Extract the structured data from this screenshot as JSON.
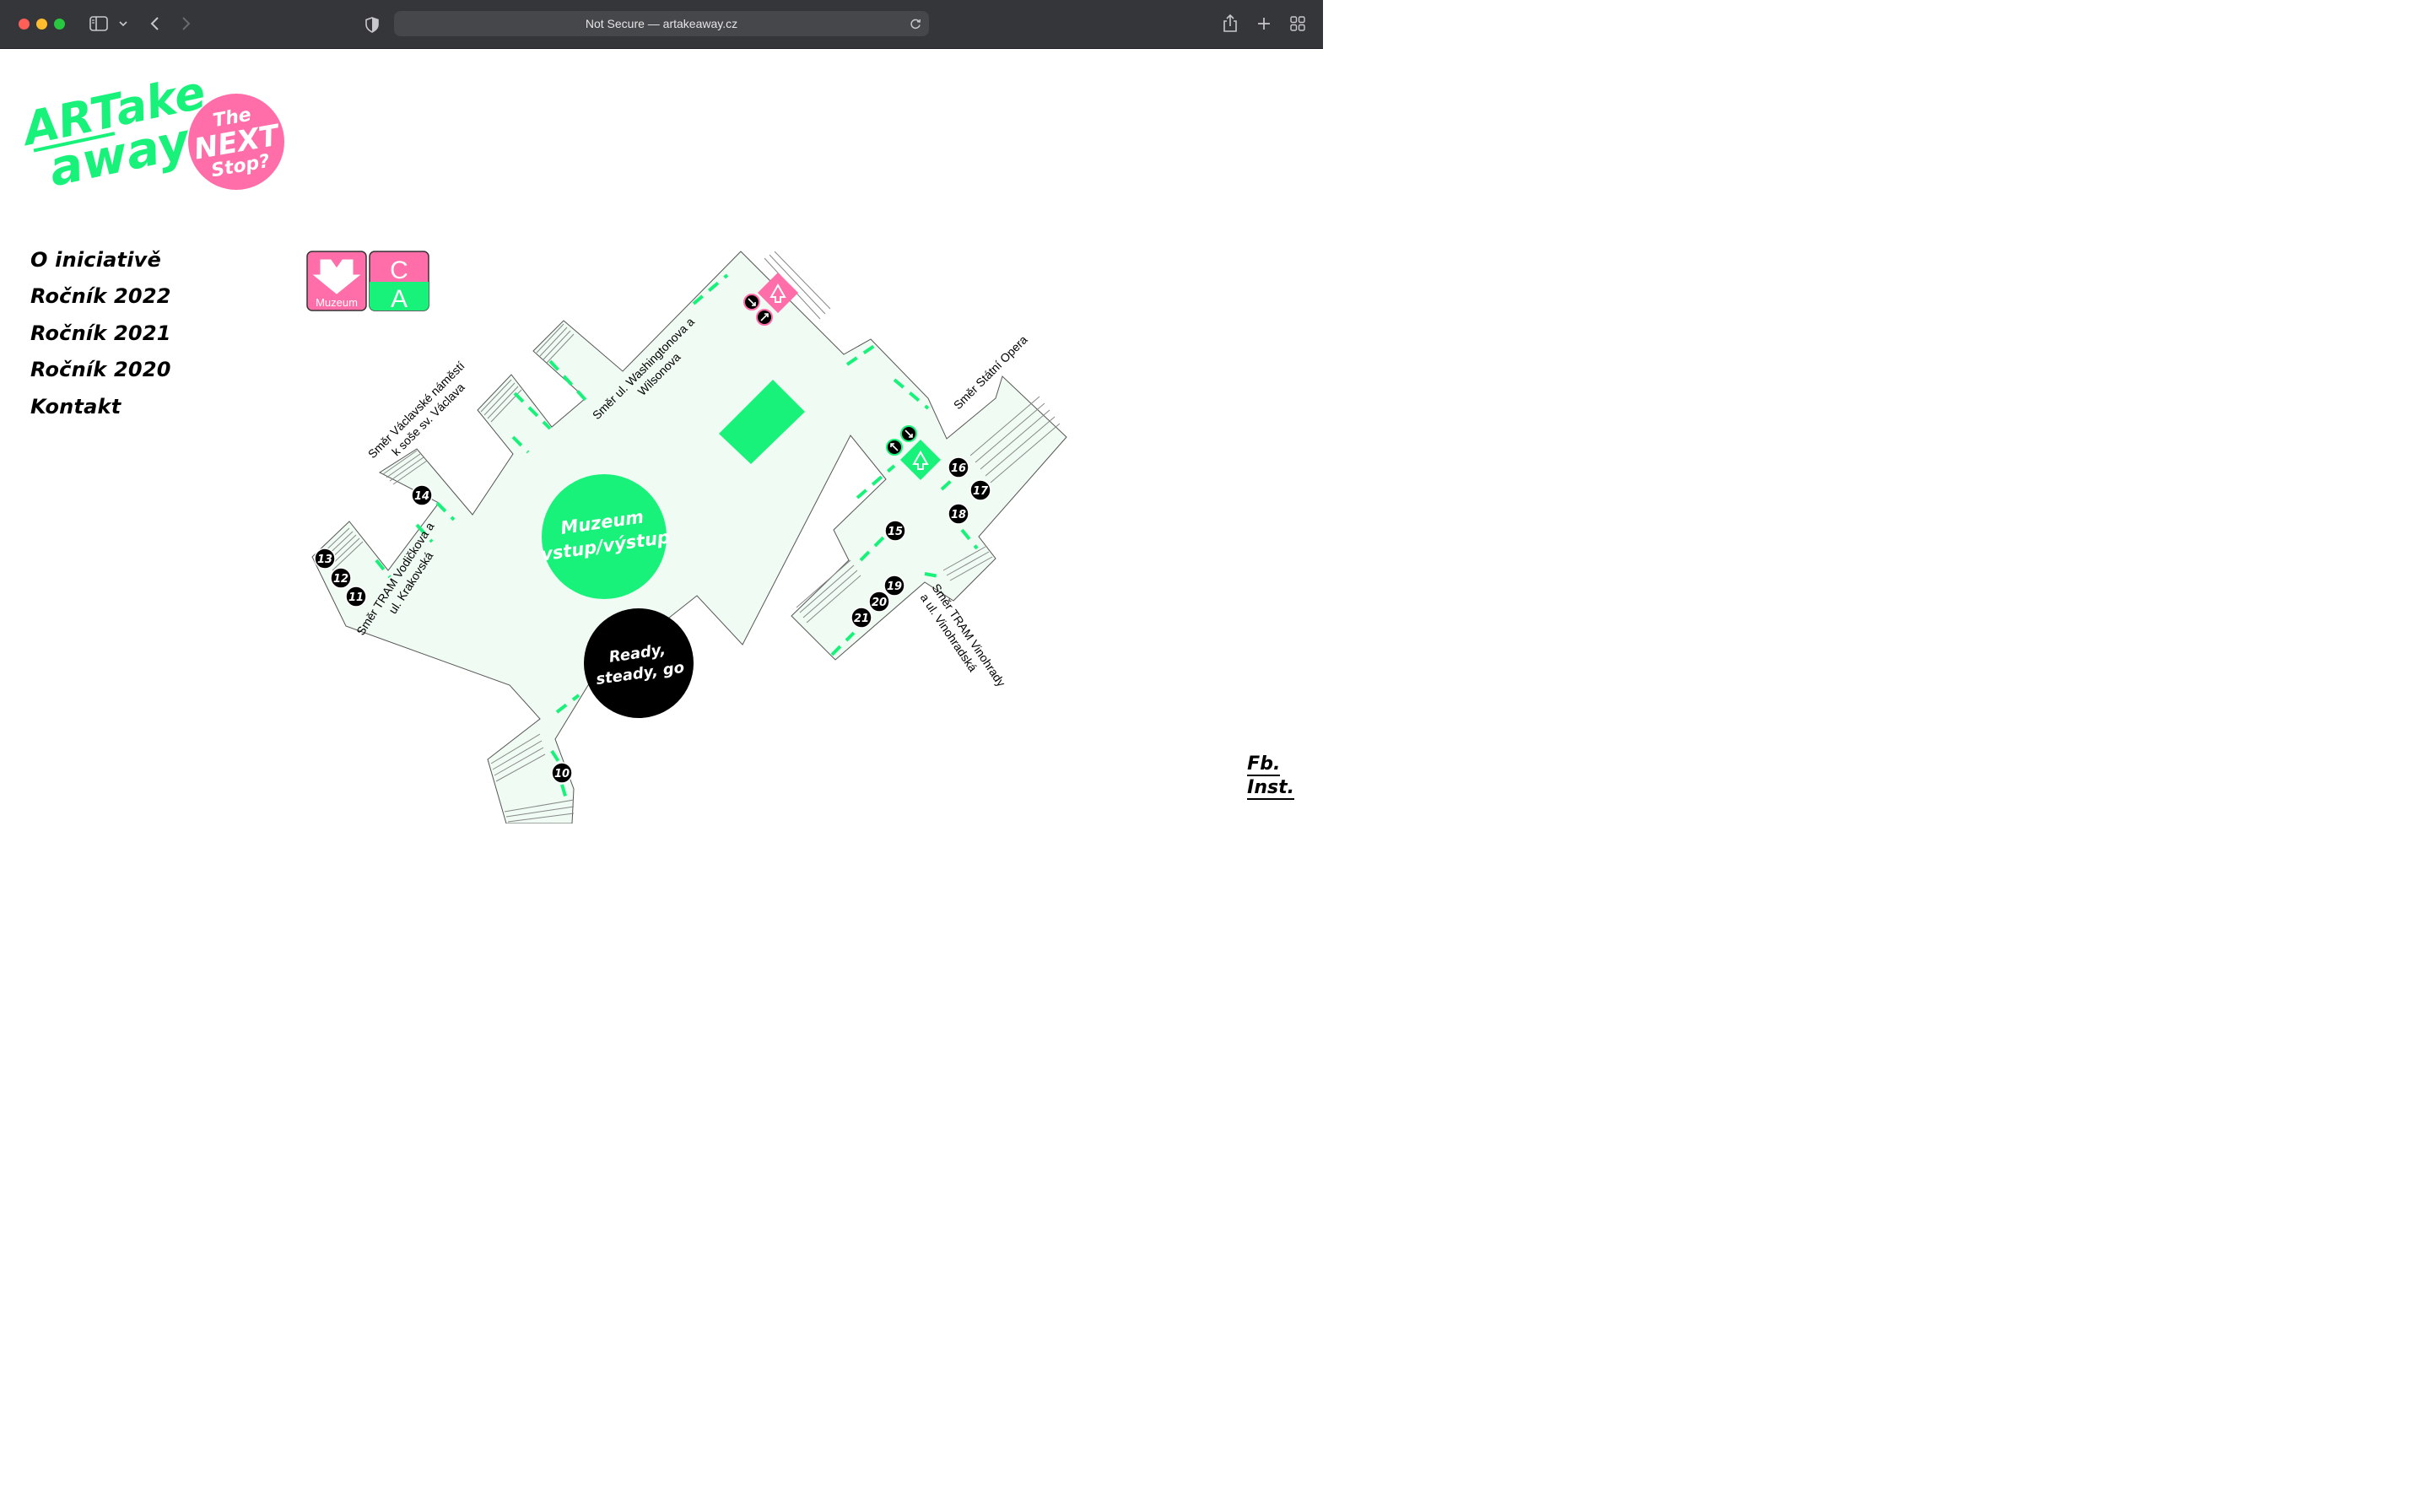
{
  "browser": {
    "url_text": "Not Secure — artakeaway.cz"
  },
  "logo": {
    "line1": "ARTake",
    "line2": "away",
    "badge": [
      "The",
      "NEXT",
      "Stop?"
    ],
    "green": "#19f27a",
    "pink": "#ff6ea8"
  },
  "nav": [
    {
      "label": "O iniciativě"
    },
    {
      "label": "Ročník 2022"
    },
    {
      "label": "Ročník 2021"
    },
    {
      "label": "Ročník 2020"
    },
    {
      "label": "Kontakt"
    }
  ],
  "map": {
    "metro_sign": {
      "station": "Muzeum",
      "lines": [
        "C",
        "A"
      ]
    },
    "labels": {
      "vaclavske": [
        "Směr Václavské náměstí",
        "k soše sv. Václava"
      ],
      "washingtonova": [
        "Směr ul. Washingtonova a",
        "Wilsonova"
      ],
      "statni_opera": "Směr Státní Opera",
      "vodickova": [
        "Směr TRAM Vodičkova a",
        "ul. Krakovská"
      ],
      "vinohrady": [
        "Směr TRAM Vinohrady",
        "a ul. Vinohradská"
      ]
    },
    "exits": [
      "10",
      "11",
      "12",
      "13",
      "14",
      "15",
      "16",
      "17",
      "18",
      "19",
      "20",
      "21"
    ],
    "muzeum_circle": [
      "Muzeum",
      "vstup/výstup"
    ],
    "ready_circle": [
      "Ready,",
      "steady, go"
    ],
    "colors": {
      "floor": "#effbf3",
      "accent": "#19f27a",
      "pink": "#ff6ea8"
    }
  },
  "social": {
    "facebook": "Fb.",
    "instagram": "Inst."
  }
}
